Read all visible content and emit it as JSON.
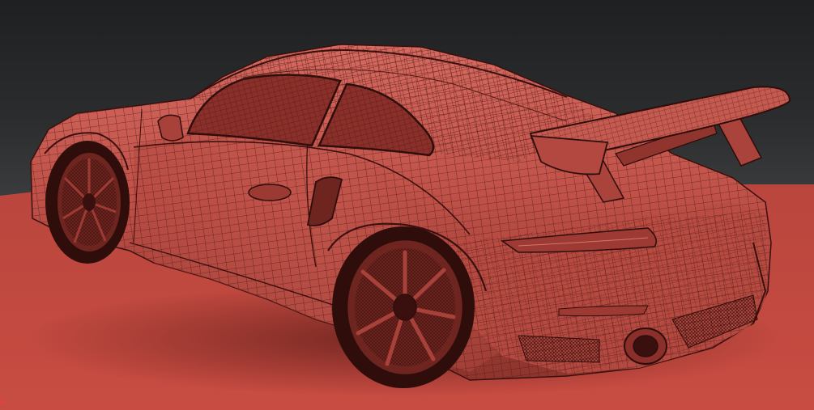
{
  "scene": {
    "subject": "car-wireframe-model",
    "colors": {
      "background_top": "#1f2021",
      "background_bottom": "#3d3e3f",
      "floor": "#c84c42",
      "floor_far": "#b9463d",
      "body_base": "#bf5148",
      "body_shadow": "#7e2c26",
      "body_highlight": "#d9756a",
      "wire": "#4a1512",
      "glass": "#8a2f29",
      "tyre": "#2e0d0b"
    }
  }
}
